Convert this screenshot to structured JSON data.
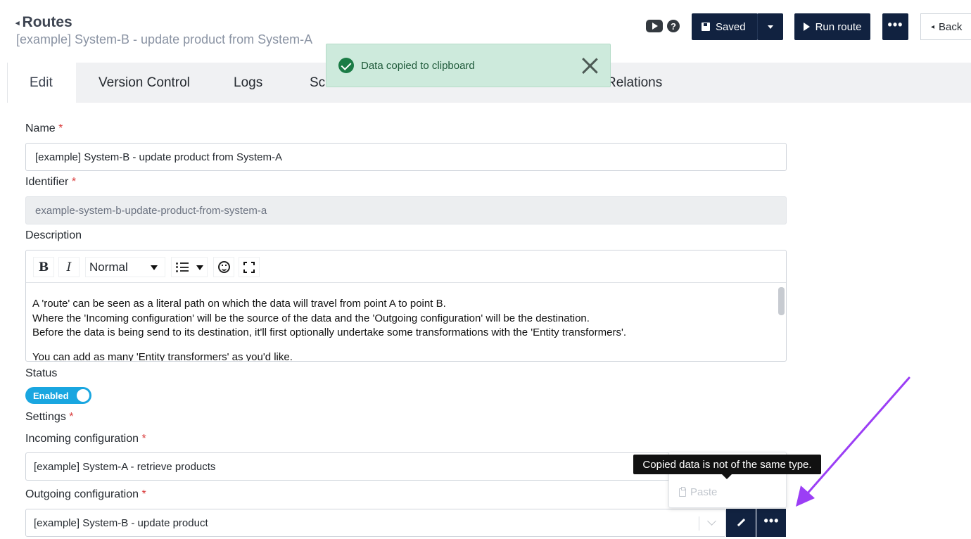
{
  "header": {
    "breadcrumb": "Routes",
    "subtitle": "[example] System-B - update product from System-A",
    "saved_label": "Saved",
    "run_label": "Run route",
    "more_label": "•••",
    "back_label": "Back"
  },
  "tabs": [
    {
      "label": "Edit",
      "active": true
    },
    {
      "label": "Version Control"
    },
    {
      "label": "Logs"
    },
    {
      "label": "Sch"
    },
    {
      "label": "Relations"
    }
  ],
  "toast": {
    "message": "Data copied to clipboard"
  },
  "form": {
    "name_label": "Name",
    "name_value": "[example] System-B - update product from System-A",
    "identifier_label": "Identifier",
    "identifier_value": "example-system-b-update-product-from-system-a",
    "description_label": "Description",
    "toolbar": {
      "bold": "B",
      "italic": "I",
      "format": "Normal"
    },
    "description_lines": [
      "A 'route' can be seen as a literal path on which the data will travel from point A to point B.",
      "Where the 'Incoming configuration' will be the source of the data and the 'Outgoing configuration' will be the destination.",
      "Before the data is being send to its destination, it'll first optionally undertake some transformations with the 'Entity transformers'.",
      "You can add as many 'Entity transformers' as you'd like."
    ],
    "status_label": "Status",
    "status_value": "Enabled",
    "settings_label": "Settings",
    "incoming_label": "Incoming configuration",
    "incoming_value": "[example] System-A - retrieve products",
    "outgoing_label": "Outgoing configuration",
    "outgoing_value": "[example] System-B - update product",
    "required_mark": "*"
  },
  "popover": {
    "tooltip": "Copied data is not of the same type.",
    "paste_label": "Paste"
  },
  "colors": {
    "primary": "#112240",
    "toggle": "#19a6e0",
    "toast_bg": "#cdeadc",
    "arrow": "#9b3ef5"
  }
}
